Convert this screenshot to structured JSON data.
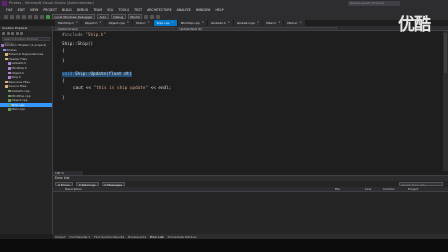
{
  "window": {
    "title": "Pirates - Microsoft Visual Studio (Administrator)",
    "quick_launch": "Quick Launch (Ctrl+Q)"
  },
  "menu": [
    "FILE",
    "EDIT",
    "VIEW",
    "PROJECT",
    "BUILD",
    "DEBUG",
    "TEAM",
    "SQL",
    "TOOLS",
    "TEST",
    "ARCHITECTURE",
    "ANALYZE",
    "WINDOW",
    "HELP"
  ],
  "toolbar": {
    "debugger": "Local Windows Debugger",
    "config": "Auto",
    "solution_config": "Debug",
    "platform": "Win32"
  },
  "solution_explorer": {
    "title": "Solution Explorer",
    "search_placeholder": "Search Solution Explorer (Ctrl+;)",
    "items": [
      {
        "label": "Solution 'Pirates' (1 project)",
        "icon": "solution-icon",
        "selected": false
      },
      {
        "label": "Pirates",
        "icon": "project-icon",
        "selected": false
      },
      {
        "label": "External Dependencies",
        "icon": "folder-icon",
        "selected": false
      },
      {
        "label": "Header Files",
        "icon": "folder-icon",
        "selected": false
      },
      {
        "label": "GlobalU.h",
        "icon": "header-icon",
        "selected": false
      },
      {
        "label": "MiniShip.h",
        "icon": "header-icon",
        "selected": false
      },
      {
        "label": "Object.h",
        "icon": "header-icon",
        "selected": false
      },
      {
        "label": "Ship.h",
        "icon": "header-icon",
        "selected": false
      },
      {
        "label": "Resource Files",
        "icon": "folder-icon",
        "selected": false
      },
      {
        "label": "Source Files",
        "icon": "folder-icon",
        "selected": false
      },
      {
        "label": "GlobalU.cpp",
        "icon": "cpp-icon",
        "selected": false
      },
      {
        "label": "MiniShip.cpp",
        "icon": "cpp-icon",
        "selected": false
      },
      {
        "label": "Object.cpp",
        "icon": "cpp-icon",
        "selected": false
      },
      {
        "label": "Ship.cpp",
        "icon": "cpp-icon",
        "selected": true
      },
      {
        "label": "Main.cpp",
        "icon": "cpp-icon",
        "selected": false
      }
    ]
  },
  "editor_tabs": [
    {
      "label": "MiniShip.h",
      "active": false
    },
    {
      "label": "Object.h",
      "active": false
    },
    {
      "label": "Object.cpp",
      "active": false
    },
    {
      "label": "Ship.h",
      "active": false
    },
    {
      "label": "Ship.cpp",
      "active": true
    },
    {
      "label": "MiniShip.cpp",
      "active": false
    },
    {
      "label": "GlobalU.h",
      "active": false
    },
    {
      "label": "GlobalU.cpp",
      "active": false
    },
    {
      "label": "Main.h",
      "active": false
    },
    {
      "label": "Main.h",
      "active": false
    }
  ],
  "nav": {
    "scope": "(Global Scope)",
    "member": "Update(float dt)"
  },
  "code": {
    "l1_pp": "#include",
    "l1_str": " \"Ship.h\"",
    "l2": "Ship::Ship()",
    "l3": "{",
    "l4": "}",
    "l5_kw1": "void",
    "l5_sel": " Ship::Update(float dt)",
    "l6": "{",
    "l7a": "cout << ",
    "l7_str": "\"this is ship update\"",
    "l7b": " << endl;",
    "l8": "}"
  },
  "zoom": "100 %",
  "error_list": {
    "title": "Error List",
    "errors": "0 Errors",
    "warnings": "0 Warnings",
    "messages": "0 Messages",
    "search_placeholder": "Search Error List",
    "columns": [
      "Description",
      "File",
      "Line",
      "Column",
      "Project"
    ]
  },
  "bottom_tabs": [
    "Output",
    "Find Results 1",
    "Find Symbol Results",
    "Breakpoints",
    "Error List",
    "Immediate Window"
  ],
  "bottom_active": "Error List",
  "watermark": "优酷",
  "colors": {
    "accent": "#007acc",
    "selection": "#3399ff",
    "keyword": "#569cd6",
    "string": "#d69d85"
  }
}
